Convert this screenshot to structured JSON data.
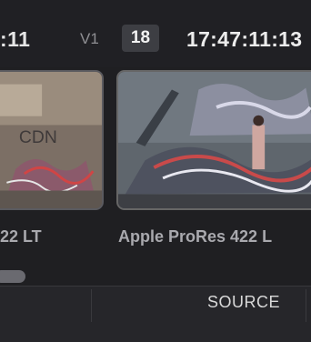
{
  "header": {
    "timecode_left": ":11",
    "track": "V1",
    "clip_count": "18",
    "timecode_right": "17:47:11:13"
  },
  "clips": [
    {
      "name": "22 LT"
    },
    {
      "name": "Apple ProRes 422 L"
    }
  ],
  "footer": {
    "source_tab": "SOURCE"
  },
  "colors": {
    "background": "#202024",
    "badge": "#3d3e43",
    "text": "#e6e6e6",
    "muted": "#a9a9ae"
  }
}
